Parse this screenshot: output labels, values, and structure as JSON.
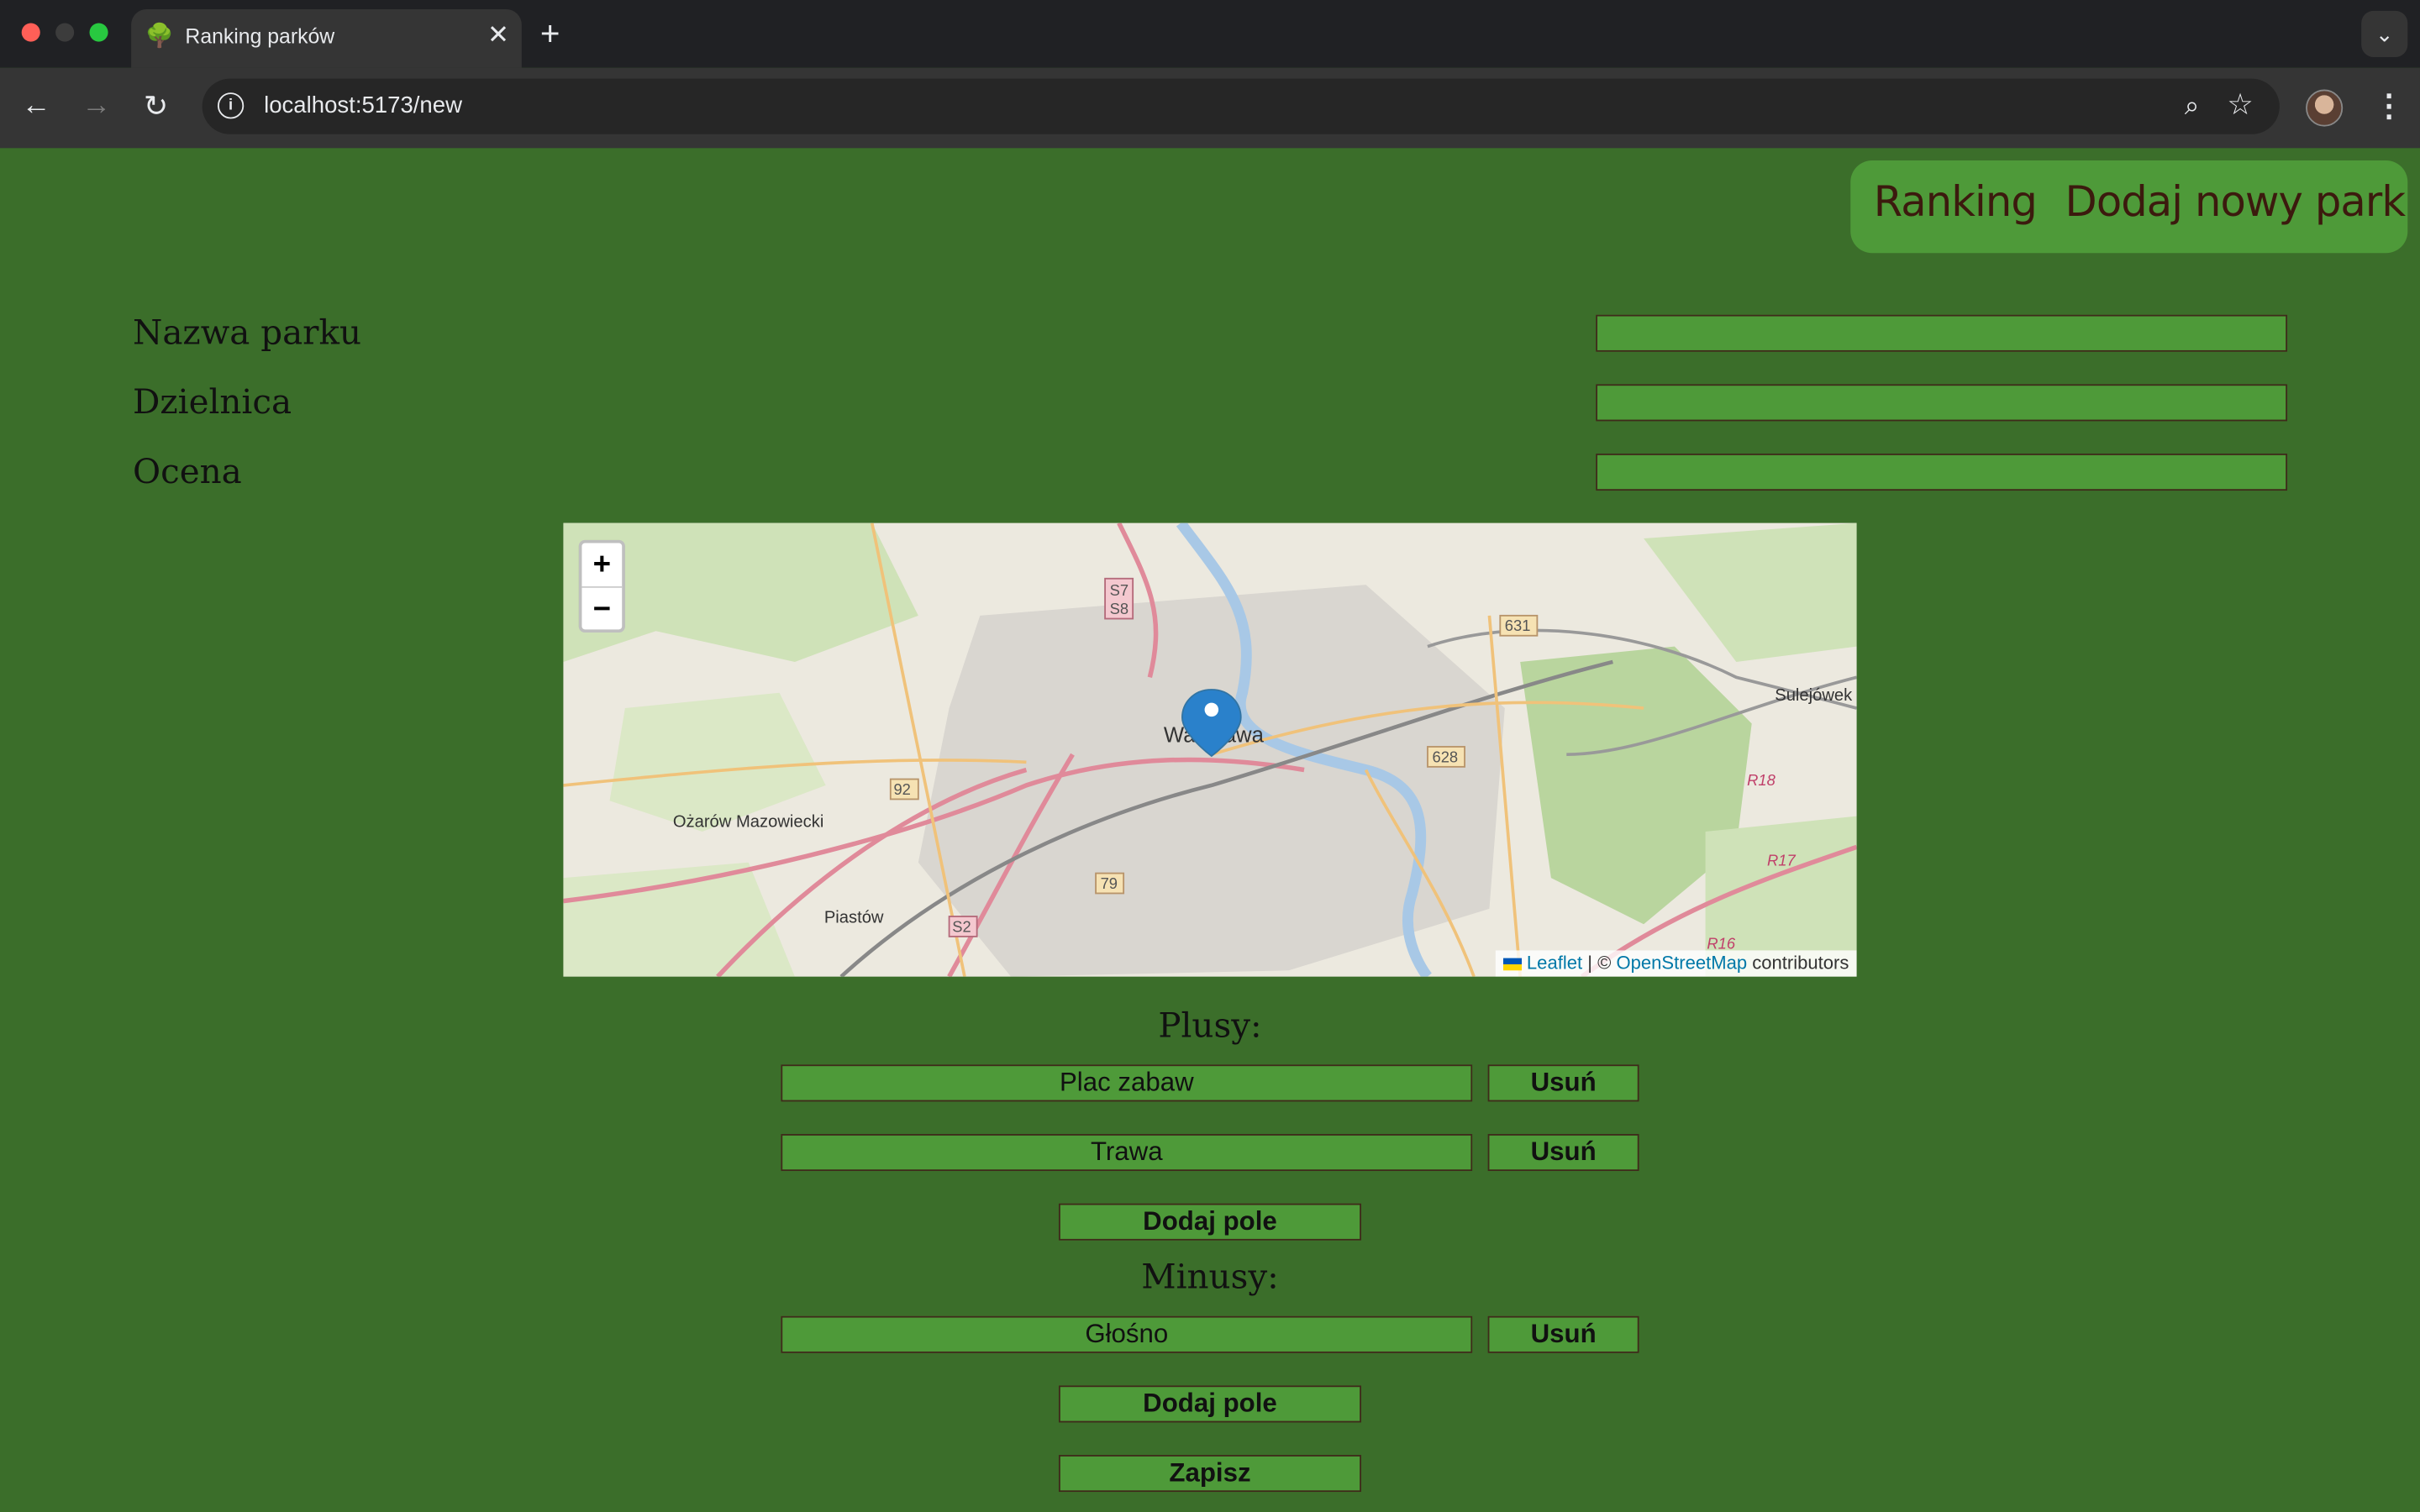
{
  "browser": {
    "tab_title": "Ranking parków",
    "tab_favicon": "🌳",
    "url": "localhost:5173/new"
  },
  "nav": {
    "ranking": "Ranking",
    "add_park": "Dodaj nowy park"
  },
  "form": {
    "name_label": "Nazwa parku",
    "district_label": "Dzielnica",
    "rating_label": "Ocena",
    "name_value": "",
    "district_value": "",
    "rating_value": ""
  },
  "map": {
    "zoom_in": "+",
    "zoom_out": "−",
    "attribution_leaflet": "Leaflet",
    "attribution_sep": "| ©",
    "attribution_osm": "OpenStreetMap",
    "attribution_tail": "contributors",
    "labels": {
      "warszawa": "Warszawa",
      "ozarow": "Ożarów Mazowiecki",
      "piastow": "Piastów",
      "sulejowek": "Sulejówek",
      "r92": "92",
      "r79": "79",
      "s2": "S2",
      "s7": "S7",
      "s8": "S8",
      "r631": "631",
      "r628": "628",
      "r18": "R18",
      "r17": "R17",
      "r16": "R16"
    }
  },
  "pros": {
    "title": "Plusy:",
    "items": [
      "Plac zabaw",
      "Trawa"
    ],
    "delete_label": "Usuń",
    "add_label": "Dodaj pole"
  },
  "cons": {
    "title": "Minusy:",
    "items": [
      "Głośno"
    ],
    "delete_label": "Usuń",
    "add_label": "Dodaj pole"
  },
  "save_label": "Zapisz"
}
